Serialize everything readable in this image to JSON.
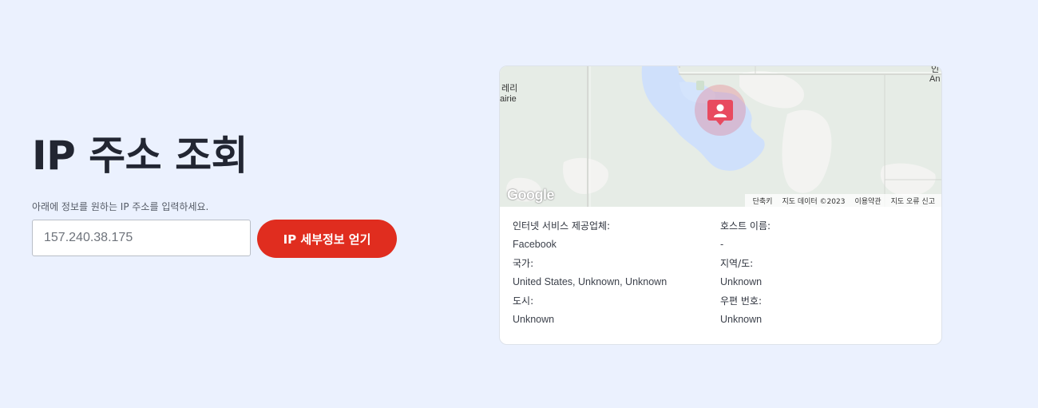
{
  "hero": {
    "title": "IP 주소 조회",
    "subtitle": "아래에 정보를 원하는 IP 주소를 입력하세요.",
    "input_placeholder": "157.240.38.175",
    "button_label": "IP 세부정보 얻기"
  },
  "map": {
    "labels": {
      "left_top": "레리",
      "left_bottom": "airie",
      "right_top": "인",
      "right_bottom": "An"
    },
    "logo": "Google",
    "footer": {
      "shortcuts": "단축키",
      "map_data": "지도 데이터 ©2023",
      "terms": "이용약관",
      "report": "지도 오류 신고"
    },
    "marker_icon": "user-pin-icon",
    "colors": {
      "water": "#cfe0fb",
      "land": "#e6ece6",
      "marker": "#e84a5f"
    }
  },
  "info": {
    "isp_label": "인터넷 서비스 제공업체:",
    "isp_value": "Facebook",
    "hostname_label": "호스트 이름:",
    "hostname_value": "-",
    "country_label": "국가:",
    "country_value": "United States, Unknown, Unknown",
    "region_label": "지역/도:",
    "region_value": "Unknown",
    "city_label": "도시:",
    "city_value": "Unknown",
    "postal_label": "우편 번호:",
    "postal_value": "Unknown"
  },
  "colors": {
    "background": "#ebf1fe",
    "accent": "#e02d1f"
  }
}
